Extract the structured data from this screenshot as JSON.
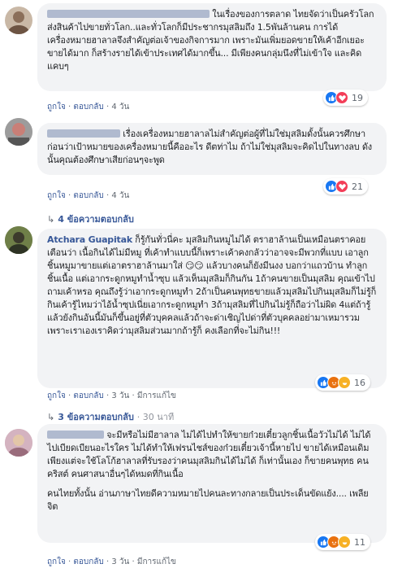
{
  "comments": [
    {
      "text": "ในเรื่องของการตลาด ไทยจัดว่าเป็นครัวโลก ส่งสินค้าไปขายทั่วโลก..และทั่วโลกก็มีประชากรมุสลิมถึง 1.5พันล้านคน การได้เครื่องหมายฮาลาลจึงสำคัญต่อเจ้าของกิจการมาก เพราะมันเพิ่มยอดขายให้เค้าอีกเยอะ ขายได้มาก ก็สร้างรายได้เข้าประเทศได้มากขึ้น... มีเพียงคนกลุ่มนึงที่ไม่เข้าใจ และคิดแคบๆ",
      "like": "ถูกใจ",
      "reply": "ตอบกลับ",
      "time": "4 วัน",
      "reactions": "19"
    },
    {
      "text": "เรื่องเครื่องหมายฮาลาลไม่สำคัญต่อผู้ที่ไม่ใช่มุสลิมดั้งนั้นควรศึกษาก่อนว่าเป้าหมายของเครื่องหมายนี้คืออะไร ดีตท่าไม ถ้าไม่ใช่มุสลิมจะคิดไปในทางลบ ดังนั้นคุณต้องศึกษาเสียก่อนๆจะพูด",
      "like": "ถูกใจ",
      "reply": "ตอบกลับ",
      "time": "4 วัน",
      "reactions": "21",
      "replies_label": "4 ข้อความตอบกลับ"
    },
    {
      "name": "Atchara Guapitak",
      "text": "ก็รู้กันทั่วนี่คะ มุสลิมกินหมูไม่ได้ ตราฮาล้านเป็นเหมือนตราคอยเตือนว่า เนื้อกินได้ไม่มีหมู ที่เค้าทำแบบนี้ก็เพราะเค้าคงกลัวว่าอาจจะมีพวกที่แบบ เอาลูกชิ้นหมูมาขายแต่เอาตราฮาล้านมาใส่ 😏😏 แล้วบางคนก็ยังมีนงง บอกว่าแถวบ้าน ทำลูกชิ้นเนื้อ แต่เอากระดูกหมูทำน้ำซุบ แล้วเห็นมุสลิมก็กินกัน 1ถ้าคนขายเป็นมุสลิม คุณเข้าไปถามเค้าหรอ คุณถึงรู้ว่าเอากระดูกหมูทำ 2ถ้าเป็นคนพุทธขายแล้วมุสลิมไปกินมุสลิมก็ไม่รู้ก็กินเค้ารู้ไหมว่าไอ้น้ำซุปเนี่ยเอากระดูกหมูทำ 3ถ้ามุสลิมที่ไปกินไม่รู้ก็ถือว่าไม่ผิด 4แต่ถ้ารู้แล้วยังกินอันนี้มันก็ขึ้นอยู่ที่ตัวบุคคลแล้วถ้าจะด่าเชิญไปด่าที่ตัวบุคคลอย่ามาเหมารวม เพราะเราเองเราคิดว่ามุสลิมส่วนมากถ้ารู้ก็ คงเลือกที่จะไม่กิน!!!",
      "like": "ถูกใจ",
      "reply": "ตอบกลับ",
      "time": "3 วัน",
      "edited": "มีการแก้ไข",
      "reactions": "16",
      "replies_label": "3 ข้อความตอบกลับ",
      "replies_time": "30 นาที"
    },
    {
      "text": "จะมีหรือไม่มีฮาลาล ไม่ได้ไปทำให้ขายก๋วยเตี๋ยวลูกชิ้นเนื้อวัวไม่ได้ ไม่ได้ไปเบียดเบียนอะไรใคร ไม่ได้ทำให้เฟรนไชส์ของก๋วยเตี๋ยวเจ้านี้หายไป ขายได้เหมือนเดิม เพียงแต่จะใช้โลโก้ฮาลาลที่รับรองว่าคนมุสลิมกินได้ไม่ได้ ก็เท่านั้นเอง ก็ขายคนพุทธ คนคริสต์ คนศาสนาอื่นๆได้หมดที่กินเนื้อ",
      "text2": "คนไทยทั้งนั้น อ่านภาษาไทยดีความหมายไปคนละทางกลายเป็นประเด็นขัดแย้ง.... เพลียจิต",
      "like": "ถูกใจ",
      "reply": "ตอบกลับ",
      "time": "3 วัน",
      "edited": "มีการแก้ไข",
      "reactions": "11"
    }
  ]
}
